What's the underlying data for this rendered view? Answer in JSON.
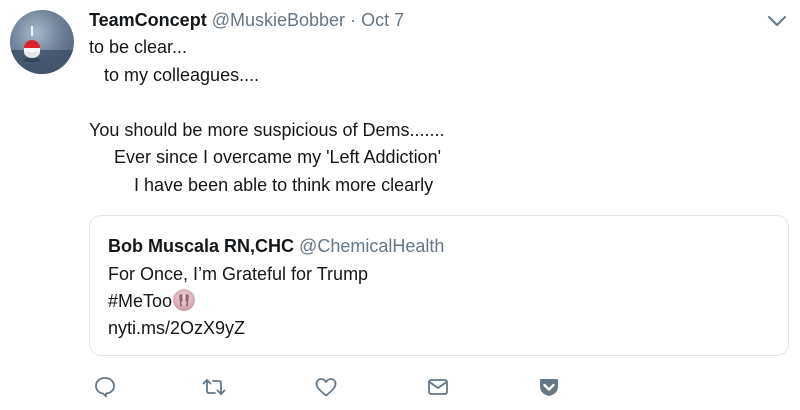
{
  "tweet": {
    "display_name": "TeamConcept",
    "handle": "@MuskieBobber",
    "separator": "·",
    "time": "Oct 7",
    "lines": [
      "to be clear...",
      "   to my colleagues....",
      "",
      "You should be more suspicious of Dems.......",
      "     Ever since I overcame my 'Left Addiction'",
      "         I have been able to think more clearly"
    ]
  },
  "quote": {
    "display_name": "Bob Muscala RN,CHC",
    "handle": "@ChemicalHealth",
    "line1": "For Once, I’m Grateful for Trump",
    "line2": "#MeToo",
    "line3": "nyti.ms/2OzX9yZ"
  },
  "icons": {
    "caret": "chevron-down-icon",
    "reply": "reply-icon",
    "retweet": "retweet-icon",
    "like": "heart-icon",
    "dm": "envelope-icon",
    "save": "pocket-icon",
    "emoji": "raising-hands-emoji"
  },
  "colors": {
    "text": "#14171a",
    "muted": "#657786",
    "border": "#e1e8ed",
    "icon": "#657786"
  }
}
